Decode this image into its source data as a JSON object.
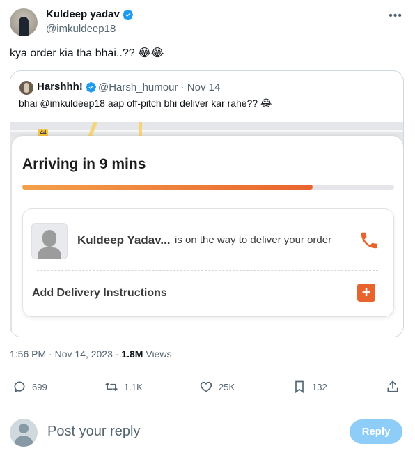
{
  "author": {
    "name": "Kuldeep yadav",
    "handle": "@imkuldeep18",
    "verified": true
  },
  "tweet": {
    "text": "kya order kia tha bhai..?? 😂😂"
  },
  "quote": {
    "name": "Harshhh!",
    "handle": "@Harsh_humour",
    "separator": "·",
    "date": "Nov 14",
    "text": "bhai @imkuldeep18 aap off-pitch bhi deliver kar rahe?? 😂",
    "media": {
      "map_shield": "44",
      "arriving": "Arriving in 9 mins",
      "progress": 0.78,
      "rider_name": "Kuldeep Yadav...",
      "rider_status": "is on the way to deliver your order",
      "instructions": "Add Delivery Instructions",
      "plus": "+"
    }
  },
  "meta": {
    "time": "1:56 PM",
    "date": "Nov 14, 2023",
    "views_count": "1.8M",
    "views_label": "Views",
    "separator": "·"
  },
  "actions": {
    "replies": "699",
    "reposts": "1.1K",
    "likes": "25K",
    "bookmarks": "132"
  },
  "reply": {
    "placeholder": "Post your reply",
    "button": "Reply"
  },
  "colors": {
    "accent": "#1d9bf0",
    "orange": "#e8642e",
    "reply_button": "#8ecdf8"
  }
}
